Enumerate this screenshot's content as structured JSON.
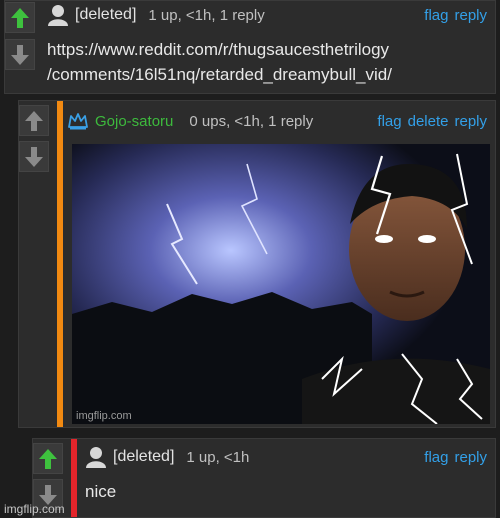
{
  "comments": [
    {
      "user": "[deleted]",
      "meta": "1 up, <1h, 1 reply",
      "actions": [
        "flag",
        "reply"
      ],
      "text": "https://www.reddit.com/r/thugsaucesthetrilogy\n/comments/16l51nq/retarded_dreamybull_vid/",
      "bar_color": "",
      "upvoted": true
    },
    {
      "user": "Gojo-satoru",
      "meta": "0 ups, <1h, 1 reply",
      "actions": [
        "flag",
        "delete",
        "reply"
      ],
      "image_watermark": "imgflip.com",
      "bar_color": "#f28a12",
      "user_color": "#3dba3d",
      "upvoted": false
    },
    {
      "user": "[deleted]",
      "meta": "1 up, <1h",
      "actions": [
        "flag",
        "reply"
      ],
      "text": "nice",
      "bar_color": "#e3252b",
      "upvoted": true
    }
  ],
  "footer_watermark": "imgflip.com",
  "colors": {
    "link": "#33a0e8",
    "upvote_active": "#3ec23e",
    "vote_idle": "#8a8a8a"
  }
}
